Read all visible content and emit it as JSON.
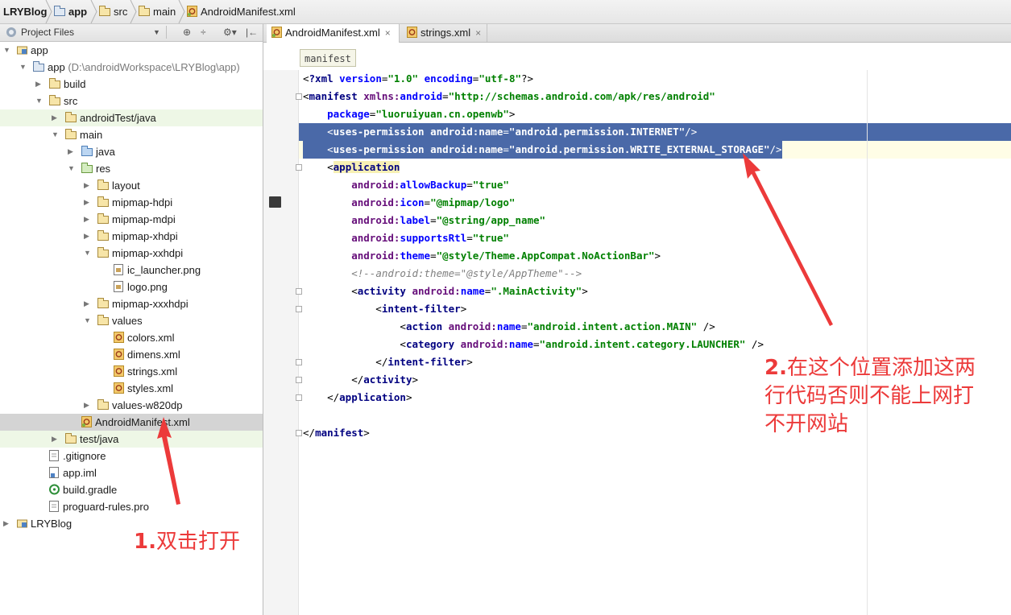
{
  "breadcrumbs": [
    "LRYBlog",
    "app",
    "src",
    "main",
    "AndroidManifest.xml"
  ],
  "panel": {
    "title": "Project Files",
    "tools": [
      "⊕",
      "÷",
      "⚙▾",
      "|←"
    ]
  },
  "tree": [
    {
      "label": "app",
      "depth": 0,
      "arrow": "▼",
      "icon": "module"
    },
    {
      "label": "app",
      "path": " (D:\\androidWorkspace\\LRYBlog\\app)",
      "depth": 1,
      "arrow": "▼",
      "icon": "folder-mod"
    },
    {
      "label": "build",
      "depth": 2,
      "arrow": "▶",
      "icon": "folder"
    },
    {
      "label": "src",
      "depth": 2,
      "arrow": "▼",
      "icon": "folder"
    },
    {
      "label": "androidTest/java",
      "depth": 3,
      "arrow": "▶",
      "icon": "folder",
      "hl": "green"
    },
    {
      "label": "main",
      "depth": 3,
      "arrow": "▼",
      "icon": "folder"
    },
    {
      "label": "java",
      "depth": 4,
      "arrow": "▶",
      "icon": "folder-blue"
    },
    {
      "label": "res",
      "depth": 4,
      "arrow": "▼",
      "icon": "folder-res"
    },
    {
      "label": "layout",
      "depth": 5,
      "arrow": "▶",
      "icon": "folder"
    },
    {
      "label": "mipmap-hdpi",
      "depth": 5,
      "arrow": "▶",
      "icon": "folder"
    },
    {
      "label": "mipmap-mdpi",
      "depth": 5,
      "arrow": "▶",
      "icon": "folder"
    },
    {
      "label": "mipmap-xhdpi",
      "depth": 5,
      "arrow": "▶",
      "icon": "folder"
    },
    {
      "label": "mipmap-xxhdpi",
      "depth": 5,
      "arrow": "▼",
      "icon": "folder"
    },
    {
      "label": "ic_launcher.png",
      "depth": 6,
      "arrow": "",
      "icon": "image"
    },
    {
      "label": "logo.png",
      "depth": 6,
      "arrow": "",
      "icon": "image"
    },
    {
      "label": "mipmap-xxxhdpi",
      "depth": 5,
      "arrow": "▶",
      "icon": "folder"
    },
    {
      "label": "values",
      "depth": 5,
      "arrow": "▼",
      "icon": "folder"
    },
    {
      "label": "colors.xml",
      "depth": 6,
      "arrow": "",
      "icon": "xml"
    },
    {
      "label": "dimens.xml",
      "depth": 6,
      "arrow": "",
      "icon": "xml"
    },
    {
      "label": "strings.xml",
      "depth": 6,
      "arrow": "",
      "icon": "xml"
    },
    {
      "label": "styles.xml",
      "depth": 6,
      "arrow": "",
      "icon": "xml"
    },
    {
      "label": "values-w820dp",
      "depth": 5,
      "arrow": "▶",
      "icon": "folder"
    },
    {
      "label": "AndroidManifest.xml",
      "depth": 4,
      "arrow": "",
      "icon": "manifest",
      "hl": "sel"
    },
    {
      "label": "test/java",
      "depth": 3,
      "arrow": "▶",
      "icon": "folder",
      "hl": "green"
    },
    {
      "label": ".gitignore",
      "depth": 2,
      "arrow": "",
      "icon": "text"
    },
    {
      "label": "app.iml",
      "depth": 2,
      "arrow": "",
      "icon": "iml"
    },
    {
      "label": "build.gradle",
      "depth": 2,
      "arrow": "",
      "icon": "gradle"
    },
    {
      "label": "proguard-rules.pro",
      "depth": 2,
      "arrow": "",
      "icon": "text"
    },
    {
      "label": "LRYBlog",
      "depth": 0,
      "arrow": "▶",
      "icon": "module"
    }
  ],
  "tabs": [
    {
      "label": "AndroidManifest.xml",
      "active": true
    },
    {
      "label": "strings.xml",
      "active": false
    }
  ],
  "close_glyph": "×",
  "xml_crumb": "manifest",
  "code_lines": [
    [
      [
        "pl",
        "<"
      ],
      [
        "tg",
        "?xml "
      ],
      [
        "at",
        "version"
      ],
      [
        "pl",
        "="
      ],
      [
        "vl",
        "\"1.0\""
      ],
      [
        "pl",
        " "
      ],
      [
        "at",
        "encoding"
      ],
      [
        "pl",
        "="
      ],
      [
        "vl",
        "\"utf-8\""
      ],
      [
        "pl",
        "?>"
      ]
    ],
    [
      [
        "pl",
        "<"
      ],
      [
        "tg",
        "manifest "
      ],
      [
        "ns",
        "xmlns:"
      ],
      [
        "at",
        "android"
      ],
      [
        "pl",
        "="
      ],
      [
        "vl",
        "\"http://schemas.android.com/apk/res/android\""
      ]
    ],
    [
      [
        "pl",
        "    "
      ],
      [
        "at",
        "package"
      ],
      [
        "pl",
        "="
      ],
      [
        "vl",
        "\"luoruiyuan.cn.openwb\""
      ],
      [
        "pl",
        ">"
      ]
    ],
    [
      [
        "pl",
        "    <"
      ],
      [
        "tg",
        "uses-permission "
      ],
      [
        "ns",
        "android:"
      ],
      [
        "at",
        "name"
      ],
      [
        "pl",
        "="
      ],
      [
        "vl",
        "\"android.permission.INTERNET\""
      ],
      [
        "pl",
        "/>"
      ]
    ],
    [
      [
        "pl",
        "    <"
      ],
      [
        "tg",
        "uses-permission "
      ],
      [
        "ns",
        "android:"
      ],
      [
        "at",
        "name"
      ],
      [
        "pl",
        "="
      ],
      [
        "vl",
        "\"android.permission.WRITE_EXTERNAL_STORAGE\""
      ],
      [
        "pl",
        "/>"
      ]
    ],
    [
      [
        "pl",
        "    <"
      ],
      [
        "tg",
        "application"
      ]
    ],
    [
      [
        "pl",
        "        "
      ],
      [
        "ns",
        "android:"
      ],
      [
        "at",
        "allowBackup"
      ],
      [
        "pl",
        "="
      ],
      [
        "vl",
        "\"true\""
      ]
    ],
    [
      [
        "pl",
        "        "
      ],
      [
        "ns",
        "android:"
      ],
      [
        "at",
        "icon"
      ],
      [
        "pl",
        "="
      ],
      [
        "vl",
        "\"@mipmap/logo\""
      ]
    ],
    [
      [
        "pl",
        "        "
      ],
      [
        "ns",
        "android:"
      ],
      [
        "at",
        "label"
      ],
      [
        "pl",
        "="
      ],
      [
        "vl",
        "\"@string/app_name\""
      ]
    ],
    [
      [
        "pl",
        "        "
      ],
      [
        "ns",
        "android:"
      ],
      [
        "at",
        "supportsRtl"
      ],
      [
        "pl",
        "="
      ],
      [
        "vl",
        "\"true\""
      ]
    ],
    [
      [
        "pl",
        "        "
      ],
      [
        "ns",
        "android:"
      ],
      [
        "at",
        "theme"
      ],
      [
        "pl",
        "="
      ],
      [
        "vl",
        "\"@style/Theme.AppCompat.NoActionBar\""
      ],
      [
        "pl",
        ">"
      ]
    ],
    [
      [
        "pl",
        "        "
      ],
      [
        "cm",
        "<!--android:theme=\"@style/AppTheme\"-->"
      ]
    ],
    [
      [
        "pl",
        "        <"
      ],
      [
        "tg",
        "activity "
      ],
      [
        "ns",
        "android:"
      ],
      [
        "at",
        "name"
      ],
      [
        "pl",
        "="
      ],
      [
        "vl",
        "\".MainActivity\""
      ],
      [
        "pl",
        ">"
      ]
    ],
    [
      [
        "pl",
        "            <"
      ],
      [
        "tg",
        "intent-filter"
      ],
      [
        "pl",
        ">"
      ]
    ],
    [
      [
        "pl",
        "                <"
      ],
      [
        "tg",
        "action "
      ],
      [
        "ns",
        "android:"
      ],
      [
        "at",
        "name"
      ],
      [
        "pl",
        "="
      ],
      [
        "vl",
        "\"android.intent.action.MAIN\""
      ],
      [
        "pl",
        " />"
      ]
    ],
    [
      [
        "pl",
        "                <"
      ],
      [
        "tg",
        "category "
      ],
      [
        "ns",
        "android:"
      ],
      [
        "at",
        "name"
      ],
      [
        "pl",
        "="
      ],
      [
        "vl",
        "\"android.intent.category.LAUNCHER\""
      ],
      [
        "pl",
        " />"
      ]
    ],
    [
      [
        "pl",
        "            </"
      ],
      [
        "tg",
        "intent-filter"
      ],
      [
        "pl",
        ">"
      ]
    ],
    [
      [
        "pl",
        "        </"
      ],
      [
        "tg",
        "activity"
      ],
      [
        "pl",
        ">"
      ]
    ],
    [
      [
        "pl",
        "    </"
      ],
      [
        "tg",
        "application"
      ],
      [
        "pl",
        ">"
      ]
    ],
    [],
    [
      [
        "pl",
        "</"
      ],
      [
        "tg",
        "manifest"
      ],
      [
        "pl",
        ">"
      ]
    ]
  ],
  "annotations": {
    "note1_num": "1.",
    "note1_text": "双击打开",
    "note2_num": "2.",
    "note2_line1": "在这个位置添加这两",
    "note2_line2": "行代码否则不能上网打",
    "note2_line3": "不开网站",
    "color": "#ec3a3a"
  }
}
